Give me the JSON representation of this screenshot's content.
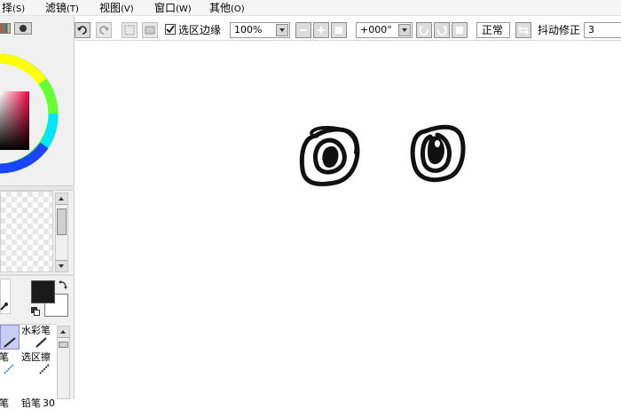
{
  "menu": [
    {
      "label": "择",
      "accel": "(S)"
    },
    {
      "label": "滤镜",
      "accel": "(T)"
    },
    {
      "label": "视图",
      "accel": "(V)"
    },
    {
      "label": "窗口",
      "accel": "(W)"
    },
    {
      "label": "其他",
      "accel": "(O)"
    }
  ],
  "toolbar": {
    "selection_edge_label": "选区边缘",
    "selection_edge_checked": true,
    "zoom_value": "100%",
    "rotation_value": "+000°",
    "blend_mode": "正常",
    "stabilizer_label": "抖动修正",
    "stabilizer_value": "3"
  },
  "colors": {
    "foreground": "#1a1a1a",
    "background": "#ffffff",
    "ink": "#111111"
  },
  "tools": [
    {
      "label": "水彩笔"
    },
    {
      "label": "喷笔"
    },
    {
      "label": "选区擦"
    },
    {
      "label": "纸笔"
    },
    {
      "label": "铅笔",
      "size": "30"
    }
  ]
}
